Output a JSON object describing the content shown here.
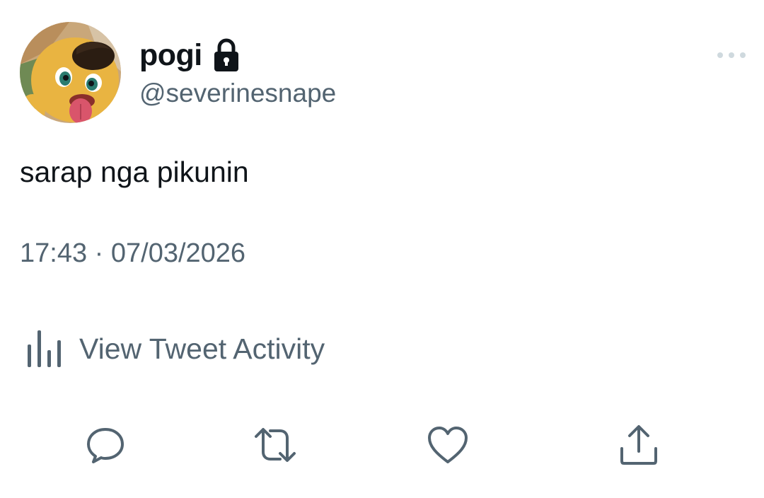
{
  "tweet": {
    "author": {
      "display_name": "pogi",
      "handle": "@severinesnape",
      "protected_icon": "lock-icon",
      "avatar": "avatar"
    },
    "more_icon": "more-horizontal-icon",
    "text": "sarap nga pikunin",
    "timestamp": "17:43 · 07/03/2026",
    "activity": {
      "icon": "bar-chart-icon",
      "label": "View Tweet Activity"
    },
    "actions": [
      {
        "name": "reply",
        "icon": "reply-icon"
      },
      {
        "name": "retweet",
        "icon": "retweet-icon"
      },
      {
        "name": "like",
        "icon": "heart-icon"
      },
      {
        "name": "share",
        "icon": "share-icon"
      }
    ],
    "colors": {
      "primary_text": "#0f1419",
      "secondary_text": "#536471",
      "background": "#ffffff"
    }
  }
}
